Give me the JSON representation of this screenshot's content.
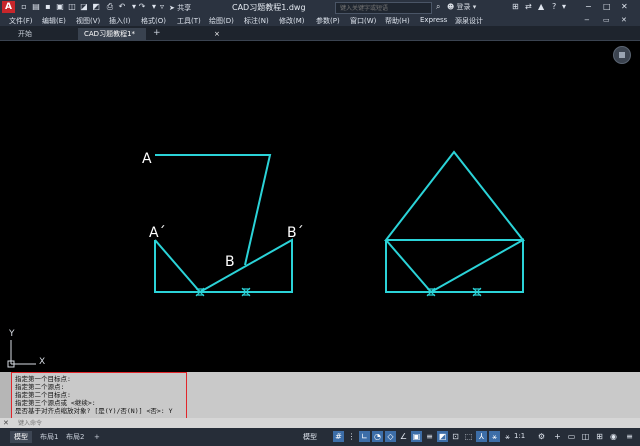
{
  "titlebar": {
    "logo": "A",
    "share": "共享",
    "doc_title": "CAD习题教程1.dwg",
    "search_placeholder": "键入关键字或短语",
    "login": "登录",
    "express": "Express"
  },
  "menus": [
    "文件(F)",
    "编辑(E)",
    "视图(V)",
    "插入(I)",
    "格式(O)",
    "工具(T)",
    "绘图(D)",
    "标注(N)",
    "修改(M)",
    "参数(P)",
    "窗口(W)",
    "帮助(H)",
    "Express",
    "源泉设计"
  ],
  "tabs": {
    "start": "开始",
    "doc": "CAD习题教程1*",
    "close": "×",
    "add": "+"
  },
  "drawing": {
    "labels": {
      "A": "A",
      "A_prime": "A´",
      "B": "B",
      "B_prime": "B´"
    },
    "ucs": {
      "x": "X",
      "y": "Y"
    },
    "colors": {
      "geometry": "#2bd3d8",
      "text": "#ffffff"
    }
  },
  "command": {
    "history": [
      "指定第一个目标点:",
      "指定第二个源点:",
      "指定第二个目标点:",
      "指定第三个源点或 <继续>:",
      "是否基于对齐点缩放对象? [是(Y)/否(N)] <否>: Y"
    ],
    "input_placeholder": "键入命令"
  },
  "status": {
    "tabs": [
      "模型",
      "布局1",
      "布局2"
    ],
    "add_tab": "+",
    "model_label": "模型",
    "scale": "1:1"
  }
}
